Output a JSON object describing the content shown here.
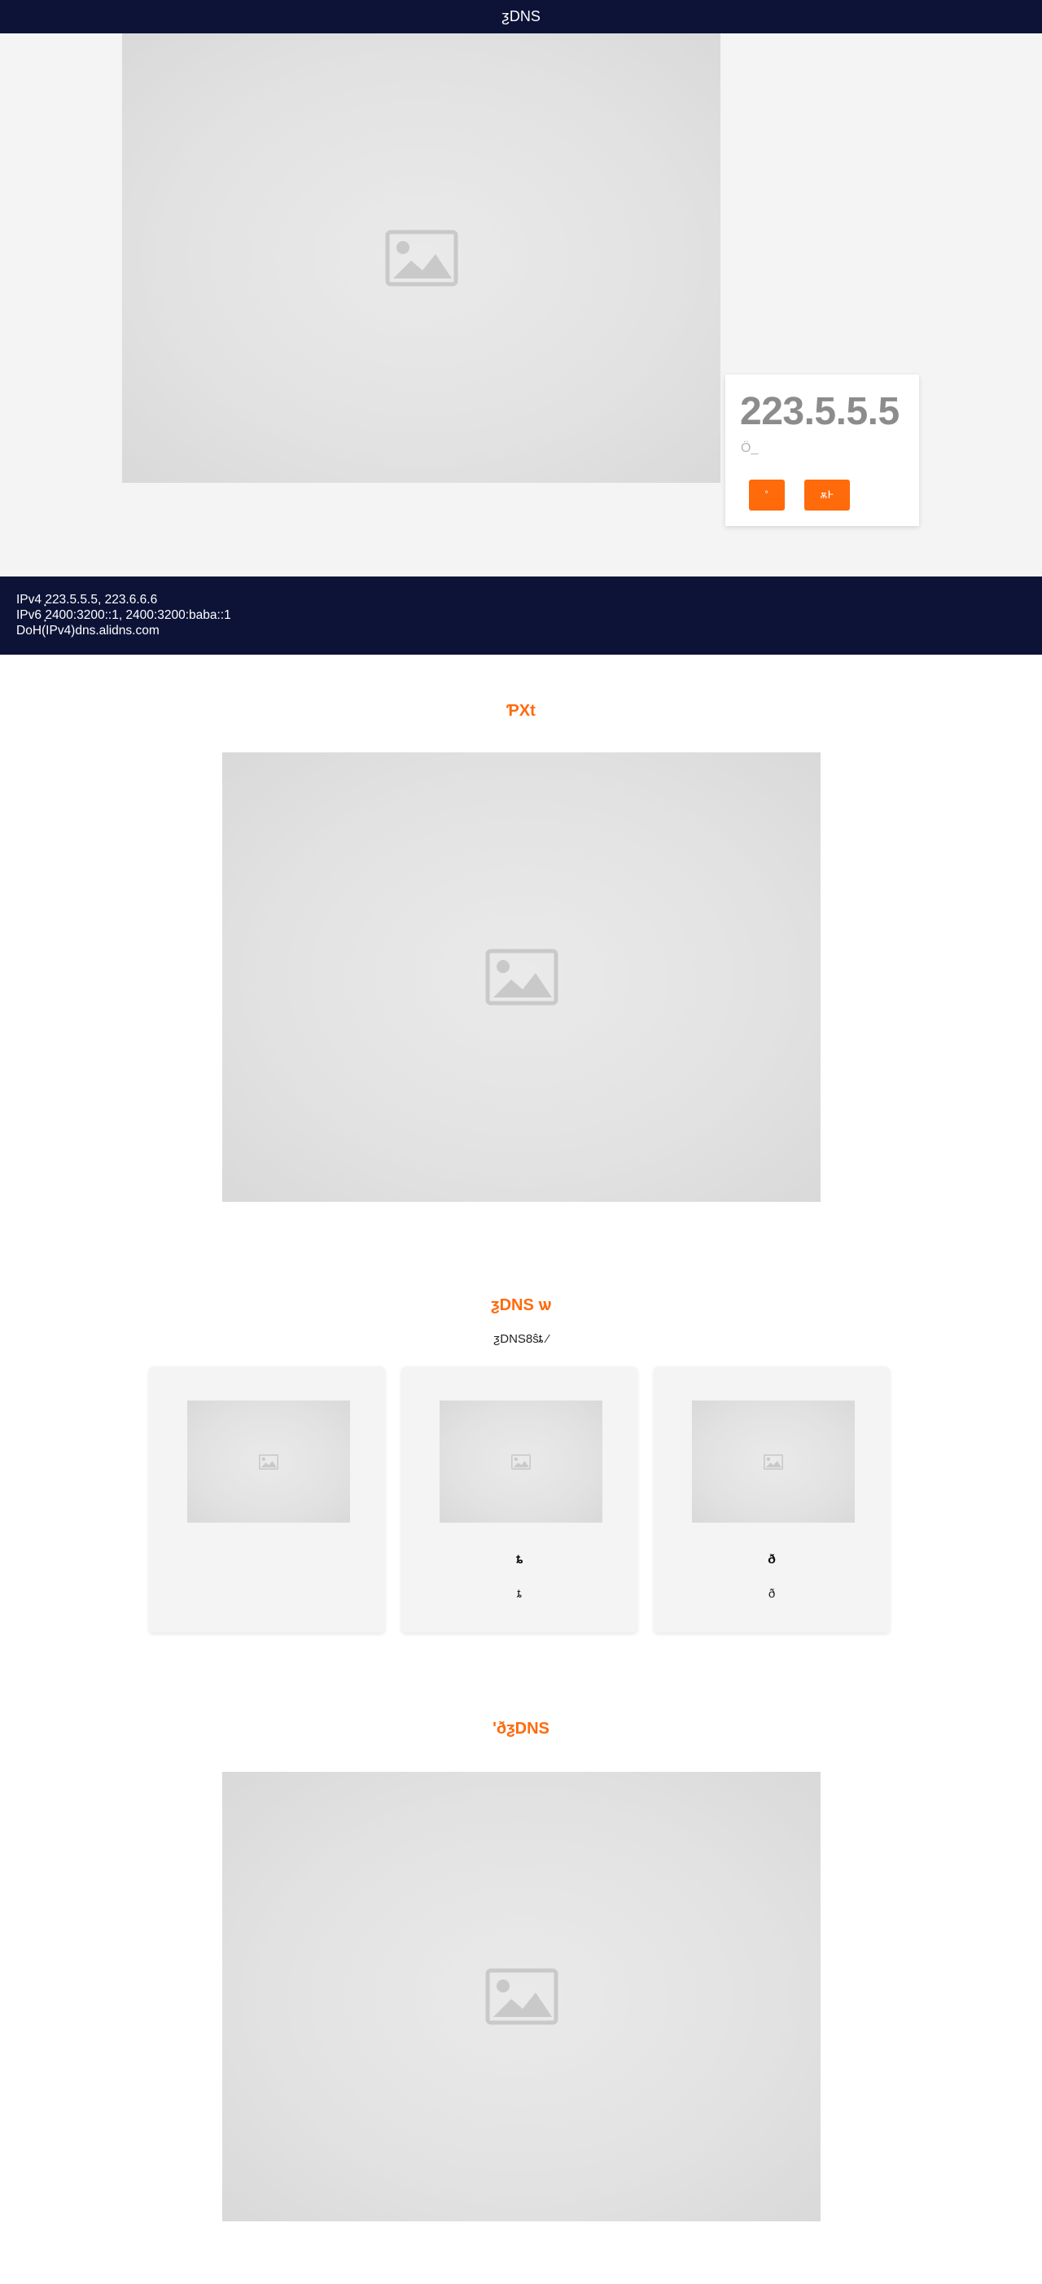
{
  "header": {
    "title": "ƺDNS"
  },
  "hero": {
    "ip": "223.5.5.5",
    "subtitle": "Ö_",
    "button_primary": "˚",
    "button_secondary": "ѫ߅"
  },
  "info": {
    "ipv4": "IPv4 ̟223.5.5.5, 223.6.6.6",
    "ipv6": "IPv6 ̟2400:3200::1, 2400:3200:baba::1",
    "doh": "DoH(IPv4)dns.alidns.com"
  },
  "section1": {
    "title": "ƤXt"
  },
  "section2": {
    "title": "ƺDNS ѡ",
    "subtitle": "ƺDNS8ŝȶ ⁄",
    "cards": [
      {
        "title": "",
        "text": ""
      },
      {
        "title": "ȶ",
        "text": "ȶ"
      },
      {
        "title": "ð",
        "text": "ð"
      }
    ]
  },
  "section3": {
    "title": "ʹðƺDNS"
  },
  "icons": {
    "image_placeholder": "image-placeholder-icon"
  },
  "colors": {
    "navy": "#0d1337",
    "accent": "#ff6a0b",
    "muted": "#8c8c8c"
  }
}
